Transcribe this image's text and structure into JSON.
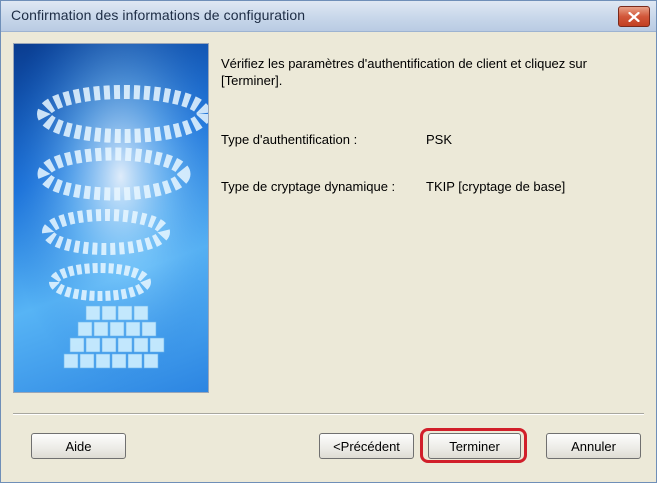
{
  "window": {
    "title": "Confirmation des informations de configuration"
  },
  "content": {
    "intro": "Vérifiez les paramètres d'authentification de client et cliquez sur [Terminer].",
    "fields": [
      {
        "label": "Type d'authentification :",
        "value": "PSK"
      },
      {
        "label": "Type de cryptage dynamique :",
        "value": "TKIP [cryptage de base]"
      }
    ]
  },
  "buttons": {
    "help": "Aide",
    "back": "<Précédent",
    "finish": "Terminer",
    "cancel": "Annuler"
  },
  "icons": {
    "close": "close-icon"
  },
  "colors": {
    "highlight": "#d11f2a",
    "close_button": "#c94a2e"
  }
}
